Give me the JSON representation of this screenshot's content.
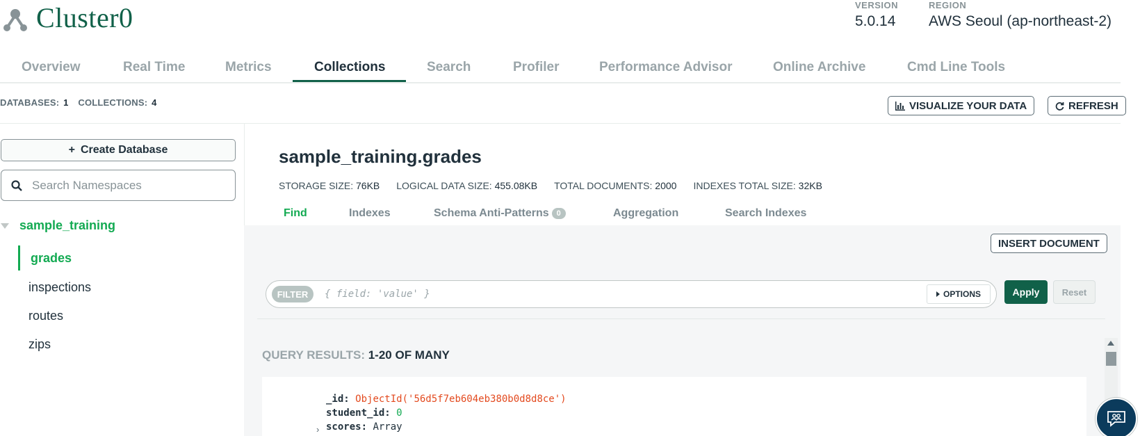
{
  "header": {
    "cluster_name": "Cluster0",
    "version_label": "VERSION",
    "version_value": "5.0.14",
    "region_label": "REGION",
    "region_value": "AWS Seoul (ap-northeast-2)"
  },
  "tabs": [
    {
      "label": "Overview",
      "active": false
    },
    {
      "label": "Real Time",
      "active": false
    },
    {
      "label": "Metrics",
      "active": false
    },
    {
      "label": "Collections",
      "active": true
    },
    {
      "label": "Search",
      "active": false
    },
    {
      "label": "Profiler",
      "active": false
    },
    {
      "label": "Performance Advisor",
      "active": false
    },
    {
      "label": "Online Archive",
      "active": false
    },
    {
      "label": "Cmd Line Tools",
      "active": false
    }
  ],
  "stats": {
    "databases_label": "DATABASES:",
    "databases_value": "1",
    "collections_label": "COLLECTIONS:",
    "collections_value": "4"
  },
  "actions": {
    "visualize_label": "VISUALIZE YOUR DATA",
    "refresh_label": "REFRESH"
  },
  "sidebar": {
    "create_db_label": "Create Database",
    "search_placeholder": "Search Namespaces",
    "database": "sample_training",
    "collections": [
      {
        "label": "grades",
        "active": true
      },
      {
        "label": "inspections",
        "active": false
      },
      {
        "label": "routes",
        "active": false
      },
      {
        "label": "zips",
        "active": false
      }
    ]
  },
  "collection": {
    "title": "sample_training.grades",
    "storage_label": "STORAGE SIZE:",
    "storage_value": "76KB",
    "logical_label": "LOGICAL DATA SIZE:",
    "logical_value": "455.08KB",
    "docs_label": "TOTAL DOCUMENTS:",
    "docs_value": "2000",
    "indexes_label": "INDEXES TOTAL SIZE:",
    "indexes_value": "32KB"
  },
  "subtabs": {
    "find": "Find",
    "indexes": "Indexes",
    "schema": "Schema Anti-Patterns",
    "schema_badge": "0",
    "aggregation": "Aggregation",
    "search_indexes": "Search Indexes"
  },
  "query": {
    "insert_label": "INSERT DOCUMENT",
    "filter_label": "FILTER",
    "filter_placeholder": "{ field: 'value' }",
    "options_label": "OPTIONS",
    "apply_label": "Apply",
    "reset_label": "Reset",
    "results_label": "QUERY RESULTS:",
    "results_value": "1-20 OF MANY"
  },
  "document": {
    "id_key": "_id:",
    "id_value": "ObjectId('56d5f7eb604eb380b0d8d8ce')",
    "student_key": "student_id:",
    "student_value": "0",
    "scores_key": "scores:",
    "scores_value": "Array"
  },
  "colors": {
    "brand_green": "#116149",
    "accent_green": "#13aa52",
    "objectid_red": "#e34a1f"
  }
}
